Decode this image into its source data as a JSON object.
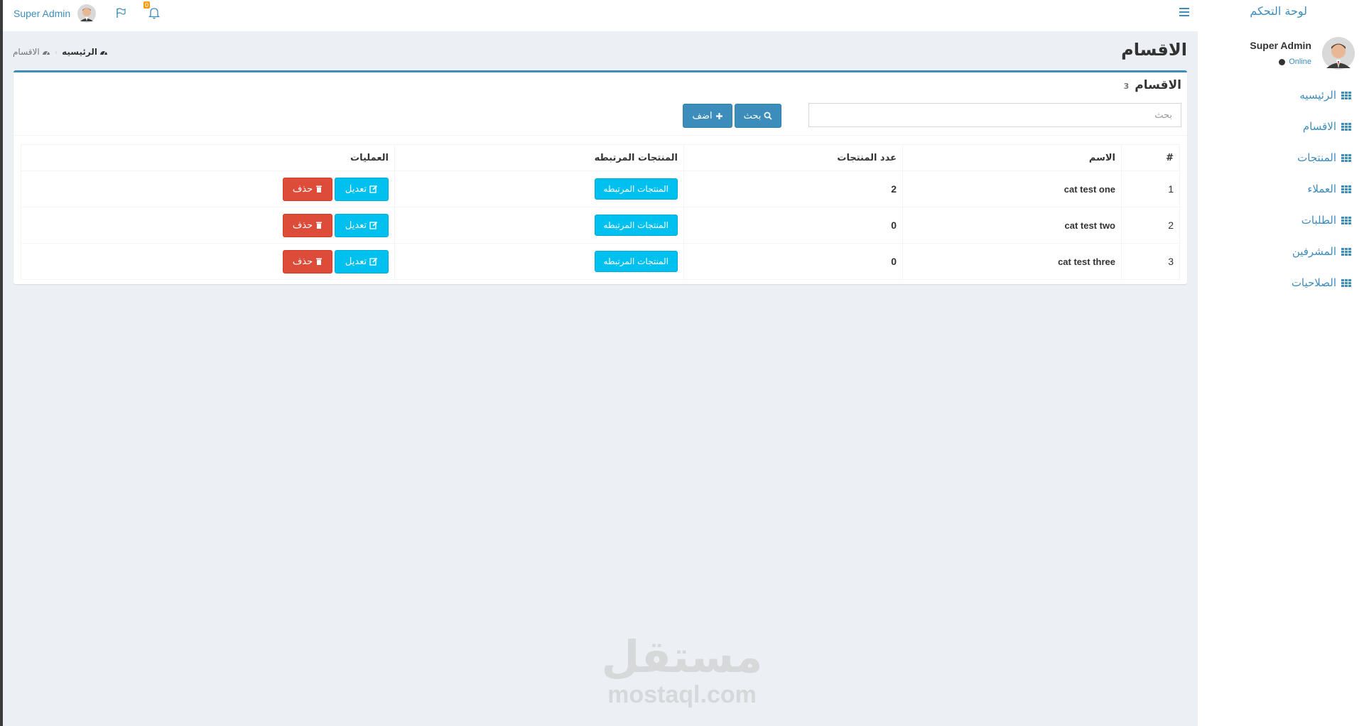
{
  "sidebar": {
    "brand": "لوحة التحكم",
    "user_name": "Super Admin",
    "user_status": "Online",
    "items": [
      {
        "label": "الرئيسيه",
        "icon": "grid-icon"
      },
      {
        "label": "الاقسام",
        "icon": "grid-icon"
      },
      {
        "label": "المنتجات",
        "icon": "grid-icon"
      },
      {
        "label": "العملاء",
        "icon": "grid-icon"
      },
      {
        "label": "الطلبات",
        "icon": "grid-icon"
      },
      {
        "label": "المشرفين",
        "icon": "grid-icon"
      },
      {
        "label": "الصلاحيات",
        "icon": "grid-icon"
      }
    ]
  },
  "header": {
    "user_name": "Super Admin",
    "notification_count": "0",
    "icons": [
      "bars-icon",
      "flag-icon",
      "bell-icon",
      "avatar"
    ]
  },
  "page": {
    "title": "الاقسام",
    "breadcrumb": {
      "home": "الرئيسيه",
      "current": "الاقسام"
    }
  },
  "box": {
    "title": "الاقسام",
    "count": "3",
    "search_placeholder": "بحث",
    "search_button": "بحث",
    "add_button": "اضف"
  },
  "table": {
    "headers": {
      "index": "#",
      "name": "الاسم",
      "count": "عدد المنتجات",
      "related": "المنتجات المرتبطه",
      "actions": "العمليات"
    },
    "rows": [
      {
        "index": "1",
        "name": "cat test one",
        "count": "2",
        "related": "المنتجات المرتبطه",
        "edit": "تعديل",
        "delete": "حذف"
      },
      {
        "index": "2",
        "name": "cat test two",
        "count": "0",
        "related": "المنتجات المرتبطه",
        "edit": "تعديل",
        "delete": "حذف"
      },
      {
        "index": "3",
        "name": "cat test three",
        "count": "0",
        "related": "المنتجات المرتبطه",
        "edit": "تعديل",
        "delete": "حذف"
      }
    ]
  },
  "watermark": {
    "arabic": "مستقل",
    "latin": "mostaql.com"
  },
  "colors": {
    "primary": "#3c8dbc",
    "info": "#00c0ef",
    "danger": "#dd4b39",
    "warning": "#f39c12",
    "background": "#ecf0f5"
  }
}
